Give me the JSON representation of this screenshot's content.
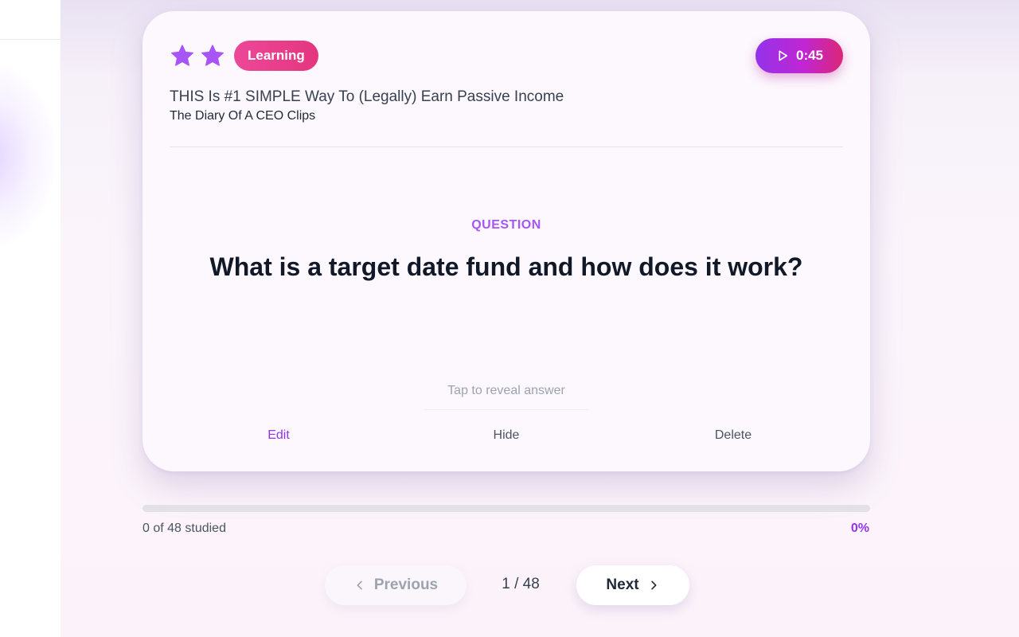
{
  "card": {
    "rating": 2,
    "badge": "Learning",
    "timer": "0:45",
    "video_title": "THIS Is #1 SIMPLE Way To (Legally) Earn Passive Income",
    "channel": "The Diary Of A CEO Clips",
    "question_label": "QUESTION",
    "question": "What is a target date fund and how does it work?",
    "reveal_hint": "Tap to reveal answer",
    "actions": {
      "edit": "Edit",
      "hide": "Hide",
      "delete": "Delete"
    }
  },
  "progress": {
    "fraction": 0,
    "studied_text": "0 of 48 studied",
    "percent_text": "0%"
  },
  "navigation": {
    "previous_label": "Previous",
    "next_label": "Next",
    "pager_text": "1 / 48"
  },
  "colors": {
    "accent": "#9333ea",
    "star": "#a855f7",
    "badge": "#ec4899",
    "question": "#111827"
  },
  "icons": {
    "star": "star-icon",
    "play": "play-icon",
    "chevron_left": "chevron-left-icon",
    "chevron_right": "chevron-right-icon"
  }
}
